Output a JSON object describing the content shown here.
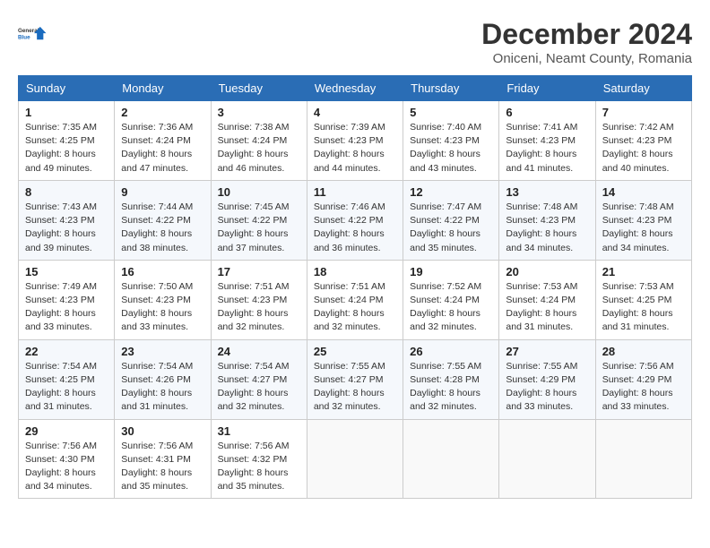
{
  "header": {
    "logo_line1": "General",
    "logo_line2": "Blue",
    "title": "December 2024",
    "subtitle": "Oniceni, Neamt County, Romania"
  },
  "weekdays": [
    "Sunday",
    "Monday",
    "Tuesday",
    "Wednesday",
    "Thursday",
    "Friday",
    "Saturday"
  ],
  "weeks": [
    [
      {
        "day": "1",
        "sunrise": "7:35 AM",
        "sunset": "4:25 PM",
        "daylight": "8 hours and 49 minutes."
      },
      {
        "day": "2",
        "sunrise": "7:36 AM",
        "sunset": "4:24 PM",
        "daylight": "8 hours and 47 minutes."
      },
      {
        "day": "3",
        "sunrise": "7:38 AM",
        "sunset": "4:24 PM",
        "daylight": "8 hours and 46 minutes."
      },
      {
        "day": "4",
        "sunrise": "7:39 AM",
        "sunset": "4:23 PM",
        "daylight": "8 hours and 44 minutes."
      },
      {
        "day": "5",
        "sunrise": "7:40 AM",
        "sunset": "4:23 PM",
        "daylight": "8 hours and 43 minutes."
      },
      {
        "day": "6",
        "sunrise": "7:41 AM",
        "sunset": "4:23 PM",
        "daylight": "8 hours and 41 minutes."
      },
      {
        "day": "7",
        "sunrise": "7:42 AM",
        "sunset": "4:23 PM",
        "daylight": "8 hours and 40 minutes."
      }
    ],
    [
      {
        "day": "8",
        "sunrise": "7:43 AM",
        "sunset": "4:23 PM",
        "daylight": "8 hours and 39 minutes."
      },
      {
        "day": "9",
        "sunrise": "7:44 AM",
        "sunset": "4:22 PM",
        "daylight": "8 hours and 38 minutes."
      },
      {
        "day": "10",
        "sunrise": "7:45 AM",
        "sunset": "4:22 PM",
        "daylight": "8 hours and 37 minutes."
      },
      {
        "day": "11",
        "sunrise": "7:46 AM",
        "sunset": "4:22 PM",
        "daylight": "8 hours and 36 minutes."
      },
      {
        "day": "12",
        "sunrise": "7:47 AM",
        "sunset": "4:22 PM",
        "daylight": "8 hours and 35 minutes."
      },
      {
        "day": "13",
        "sunrise": "7:48 AM",
        "sunset": "4:23 PM",
        "daylight": "8 hours and 34 minutes."
      },
      {
        "day": "14",
        "sunrise": "7:48 AM",
        "sunset": "4:23 PM",
        "daylight": "8 hours and 34 minutes."
      }
    ],
    [
      {
        "day": "15",
        "sunrise": "7:49 AM",
        "sunset": "4:23 PM",
        "daylight": "8 hours and 33 minutes."
      },
      {
        "day": "16",
        "sunrise": "7:50 AM",
        "sunset": "4:23 PM",
        "daylight": "8 hours and 33 minutes."
      },
      {
        "day": "17",
        "sunrise": "7:51 AM",
        "sunset": "4:23 PM",
        "daylight": "8 hours and 32 minutes."
      },
      {
        "day": "18",
        "sunrise": "7:51 AM",
        "sunset": "4:24 PM",
        "daylight": "8 hours and 32 minutes."
      },
      {
        "day": "19",
        "sunrise": "7:52 AM",
        "sunset": "4:24 PM",
        "daylight": "8 hours and 32 minutes."
      },
      {
        "day": "20",
        "sunrise": "7:53 AM",
        "sunset": "4:24 PM",
        "daylight": "8 hours and 31 minutes."
      },
      {
        "day": "21",
        "sunrise": "7:53 AM",
        "sunset": "4:25 PM",
        "daylight": "8 hours and 31 minutes."
      }
    ],
    [
      {
        "day": "22",
        "sunrise": "7:54 AM",
        "sunset": "4:25 PM",
        "daylight": "8 hours and 31 minutes."
      },
      {
        "day": "23",
        "sunrise": "7:54 AM",
        "sunset": "4:26 PM",
        "daylight": "8 hours and 31 minutes."
      },
      {
        "day": "24",
        "sunrise": "7:54 AM",
        "sunset": "4:27 PM",
        "daylight": "8 hours and 32 minutes."
      },
      {
        "day": "25",
        "sunrise": "7:55 AM",
        "sunset": "4:27 PM",
        "daylight": "8 hours and 32 minutes."
      },
      {
        "day": "26",
        "sunrise": "7:55 AM",
        "sunset": "4:28 PM",
        "daylight": "8 hours and 32 minutes."
      },
      {
        "day": "27",
        "sunrise": "7:55 AM",
        "sunset": "4:29 PM",
        "daylight": "8 hours and 33 minutes."
      },
      {
        "day": "28",
        "sunrise": "7:56 AM",
        "sunset": "4:29 PM",
        "daylight": "8 hours and 33 minutes."
      }
    ],
    [
      {
        "day": "29",
        "sunrise": "7:56 AM",
        "sunset": "4:30 PM",
        "daylight": "8 hours and 34 minutes."
      },
      {
        "day": "30",
        "sunrise": "7:56 AM",
        "sunset": "4:31 PM",
        "daylight": "8 hours and 35 minutes."
      },
      {
        "day": "31",
        "sunrise": "7:56 AM",
        "sunset": "4:32 PM",
        "daylight": "8 hours and 35 minutes."
      },
      null,
      null,
      null,
      null
    ]
  ],
  "labels": {
    "sunrise": "Sunrise:",
    "sunset": "Sunset:",
    "daylight": "Daylight:"
  }
}
